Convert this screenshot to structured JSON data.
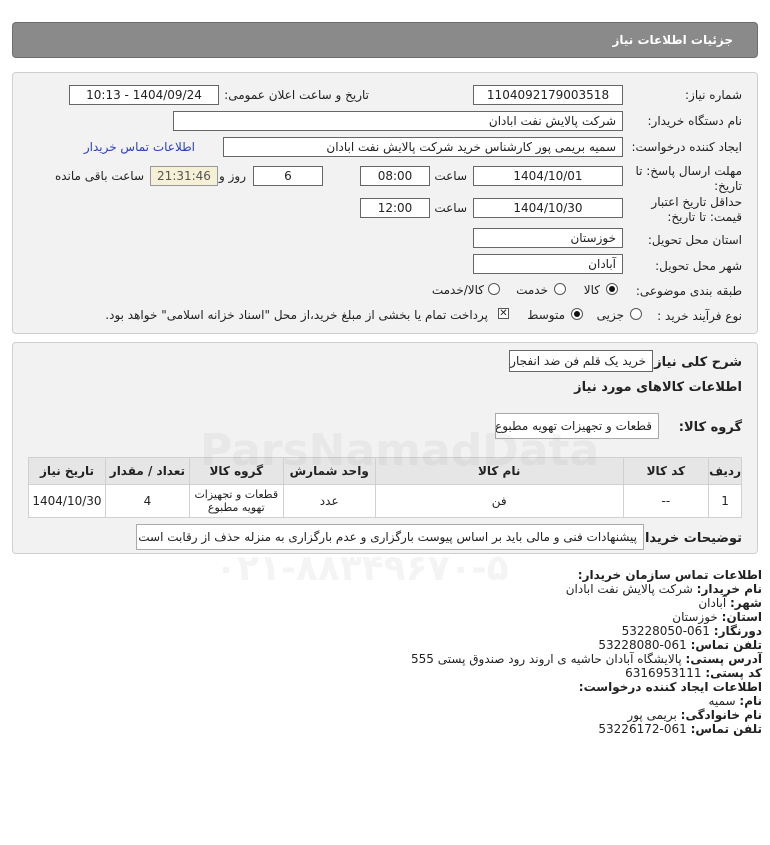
{
  "title": "جزئیات اطلاعات نیاز",
  "need": {
    "number_label": "شماره نیاز:",
    "number": "1104092179003518",
    "announce_label": "تاریخ و ساعت اعلان عمومی:",
    "announce": "1404/09/24 - 10:13",
    "buyer_label": "نام دستگاه خریدار:",
    "buyer": "شرکت پالایش نفت ابادان",
    "creator_label": "ایجاد کننده درخواست:",
    "creator": "سمیه بریمی پور کارشناس خرید شرکت پالایش نفت ابادان",
    "contact_link": "اطلاعات تماس خریدار",
    "deadline_label1": "مهلت ارسال پاسخ: تا",
    "deadline_label2": "تاریخ:",
    "deadline_date": "1404/10/01",
    "time_label": "ساعت",
    "deadline_time": "08:00",
    "days": "6",
    "days_label": "روز و",
    "remaining": "21:31:46",
    "remaining_label": "ساعت باقی مانده",
    "validity_label1": "حداقل تاریخ اعتبار",
    "validity_label2": "قیمت: تا تاریخ:",
    "validity_date": "1404/10/30",
    "validity_time": "12:00",
    "province_label": "استان محل تحویل:",
    "province": "خوزستان",
    "city_label": "شهر محل تحویل:",
    "city": "آبادان",
    "category_label": "طبقه بندی موضوعی:",
    "category_options": [
      "کالا",
      "خدمت",
      "کالا/خدمت"
    ],
    "category_selected": "کالا",
    "process_label": "نوع فرآیند خرید :",
    "process_options": [
      "جزیی",
      "متوسط"
    ],
    "process_selected": "متوسط",
    "payment_note": "پرداخت تمام یا بخشی از مبلغ خرید،از محل \"اسناد خزانه اسلامی\" خواهد بود."
  },
  "summary": {
    "desc_label": "شرح کلی نیاز:",
    "desc": "خرید یک قلم فن ضد انفجار",
    "goods_info_title": "اطلاعات کالاهای مورد نیاز",
    "group_label": "گروه کالا:",
    "group": "قطعات و تجهیزات تهویه مطبوع",
    "table": {
      "headers": [
        "ردیف",
        "کد کالا",
        "نام کالا",
        "واحد شمارش",
        "گروه کالا",
        "تعداد / مقدار",
        "تاریخ نیاز"
      ],
      "rows": [
        [
          "1",
          "--",
          "فن",
          "عدد",
          "قطعات و تجهیزات تهویه مطبوع",
          "4",
          "1404/10/30"
        ]
      ]
    },
    "buyer_notes_label": "توضیحات خریدار:",
    "buyer_notes": "پیشنهادات فنی و مالی باید بر اساس پیوست بارگزاری و عدم بارگزاری به منزله حذف از رقابت است."
  },
  "contact": {
    "org_title": "اطلاعات تماس سازمان خریدار:",
    "buyer_name_label": "نام خریدار:",
    "buyer_name": "شرکت پالایش نفت ابادان",
    "city_label": "شهر:",
    "city": "آبادان",
    "province_label": "استان:",
    "province": "خوزستان",
    "fax_label": "دورنگار:",
    "fax": "061-53228050",
    "phone_label": "تلفن تماس:",
    "phone": "061-53228080",
    "address_label": "آدرس پستی:",
    "address": "پالایشگاه آبادان حاشیه ی اروند رود صندوق پستی 555",
    "postal_label": "کد پستی:",
    "postal": "6316953111",
    "creator_title": "اطلاعات ایجاد کننده درخواست:",
    "first_name_label": "نام:",
    "first_name": "سمیه",
    "last_name_label": "نام خانوادگی:",
    "last_name": "بریمی پور",
    "creator_phone_label": "تلفن تماس:",
    "creator_phone": "061-53226172"
  },
  "watermark": {
    "brand": "ParsNamadData",
    "number": "۰۲۱-۸۸۳۴۹۶۷۰-۵"
  }
}
